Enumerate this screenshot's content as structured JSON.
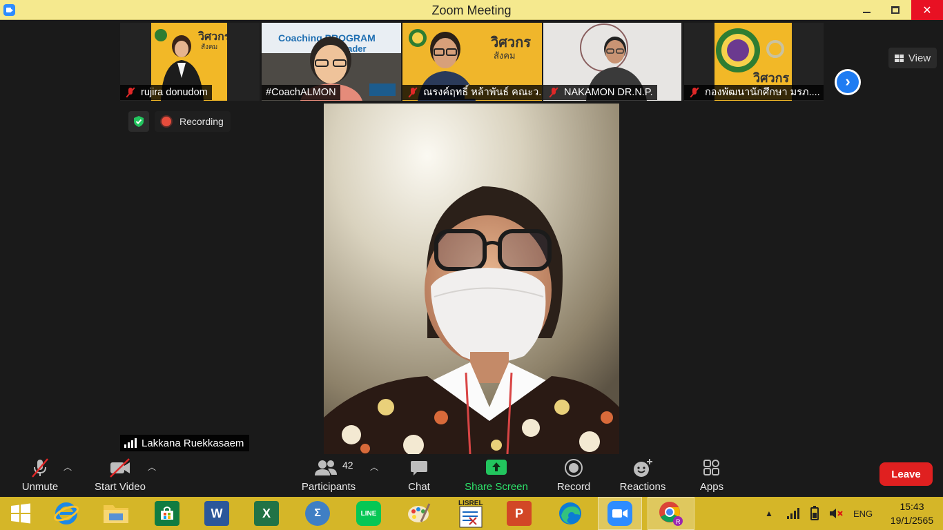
{
  "window": {
    "title": "Zoom Meeting"
  },
  "top_controls": {
    "view_label": "View"
  },
  "thumbnails": [
    {
      "name": "rujira donudom"
    },
    {
      "name": "#CoachALMON"
    },
    {
      "name": "ณรงค์ฤทธิ์ หล้าพันธ์ คณะว..."
    },
    {
      "name": "NAKAMON DR.N.P."
    },
    {
      "name": "กองพัฒนานักศึกษา มรภ...."
    }
  ],
  "status": {
    "recording_label": "Recording"
  },
  "active_speaker": {
    "name": "Lakkana Ruekkasaem"
  },
  "toolbar": {
    "unmute_label": "Unmute",
    "start_video_label": "Start Video",
    "participants_label": "Participants",
    "participants_count": "42",
    "chat_label": "Chat",
    "share_screen_label": "Share Screen",
    "record_label": "Record",
    "reactions_label": "Reactions",
    "apps_label": "Apps",
    "leave_label": "Leave"
  },
  "taskbar": {
    "apps": [
      "windows-start",
      "internet-explorer",
      "file-explorer",
      "store",
      "word",
      "excel",
      "calculator",
      "line",
      "paint",
      "lisrel",
      "powerpoint",
      "edge",
      "zoom",
      "chrome"
    ],
    "language": "ENG",
    "time": "15:43",
    "date": "19/1/2565"
  },
  "colors": {
    "title_bar": "#f5e98e",
    "taskbar": "#d5b628",
    "leave": "#e02020",
    "share_green": "#2ee26b"
  }
}
